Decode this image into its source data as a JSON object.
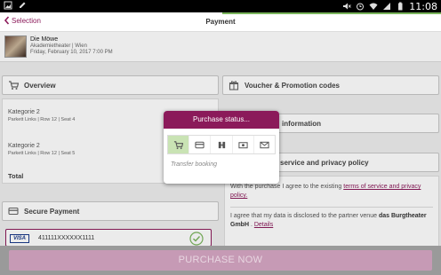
{
  "status_bar": {
    "time": "11:08",
    "icons": [
      "gallery-icon",
      "edit-icon",
      "mute-icon",
      "alarm-icon",
      "wifi-icon",
      "signal-icon",
      "battery-icon"
    ]
  },
  "header": {
    "back_label": "Selection",
    "title": "Payment"
  },
  "event": {
    "name": "Die Möwe",
    "venue": "Akademietheater | Wien",
    "date": "Friday, February 10, 2017 7:00 PM"
  },
  "overview": {
    "title": "Overview",
    "tickets": [
      {
        "category": "Kategorie 2",
        "seat": "Parkett Links | Row 12 | Seat 4"
      },
      {
        "category": "Kategorie 2",
        "seat": "Parkett Links | Row 12 | Seat 5"
      }
    ],
    "total_label": "Total"
  },
  "secure_payment": {
    "title": "Secure Payment",
    "card_brand": "VISA",
    "card_number": "411111XXXXXX1111"
  },
  "voucher": {
    "title": "Voucher & Promotion codes"
  },
  "information": {
    "title": "information"
  },
  "terms_section": {
    "title": "service and privacy policy",
    "agree_prefix": "With the purchase I agree to the existing ",
    "agree_link": "terms of service and privacy policy.",
    "disclose_prefix": "I agree that my data is disclosed to the partner venue ",
    "partner": "das Burgtheater GmbH",
    "disclose_mid": " . ",
    "details_link": "Details"
  },
  "popup": {
    "title": "Purchase status...",
    "steps": [
      "cart-icon",
      "credit-card-icon",
      "barcode-icon",
      "money-icon",
      "mail-icon"
    ],
    "active_step": 0,
    "status_text": "Transfer booking"
  },
  "purchase_button": "PURCHASE NOW",
  "colors": {
    "brand": "#8b1a5a",
    "accent_green": "#7ab55c",
    "active_step": "#c9e3b4"
  }
}
